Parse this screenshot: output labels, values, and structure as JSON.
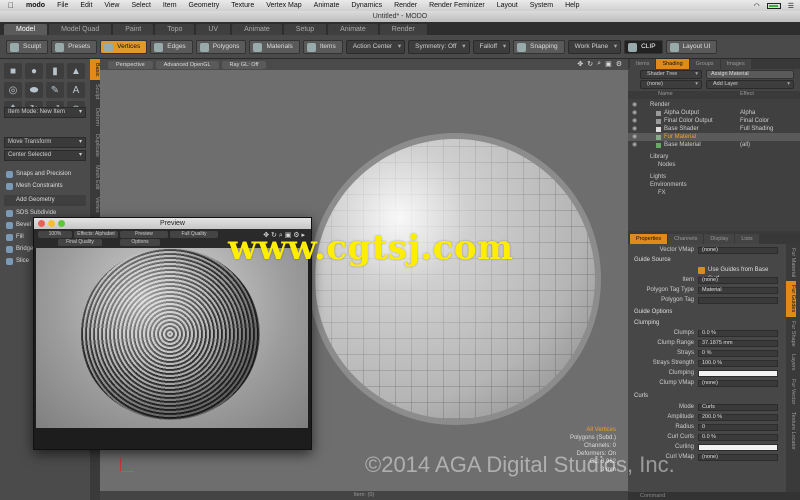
{
  "menubar": {
    "app": "modo",
    "items": [
      "File",
      "Edit",
      "View",
      "Select",
      "Item",
      "Geometry",
      "Texture",
      "Vertex Map",
      "Animate",
      "Dynamics",
      "Render",
      "Render Feminizer",
      "Layout",
      "System",
      "Help"
    ]
  },
  "window": {
    "title": "Untitled* - MODO"
  },
  "layout_tabs": [
    "Model",
    "Model Quad",
    "Paint",
    "Topo",
    "UV",
    "Animate",
    "Setup",
    "Animate",
    "Render"
  ],
  "toolbar": {
    "buttons": [
      "Sculpt",
      "Presets",
      "Vertices",
      "Edges",
      "Polygons",
      "Materials",
      "Items"
    ],
    "dropdowns": [
      "Action Center",
      "Symmetry: Off",
      "Falloff"
    ],
    "snapping": "Snapping",
    "work_plane": "Work Plane",
    "clip": "CLIP",
    "layout_label": "Layout UI"
  },
  "left_panel": {
    "vtabs": [
      "Basic",
      "Sculpt",
      "Deform",
      "Duplicate",
      "Mesh Edit",
      "Vertex"
    ],
    "dropdown1": "Item Mode: New Item",
    "transform": "Move Transform",
    "center": "Center Selected",
    "btn_snaps": "Snaps and Precision",
    "btn_mesh": "Mesh Constraints",
    "btn_add": "Add Geometry",
    "list_items": [
      "SDS Subdivide",
      "Bevel",
      "Fill",
      "Bridge",
      "Slice"
    ]
  },
  "viewport": {
    "tabs": [
      "Perspective",
      "Advanced OpenGL",
      "Ray GL: Off"
    ],
    "stats": [
      "All Vertices",
      "Polygons (Subd.)",
      "Channels: 0",
      "Deformers: On",
      "GL: 8,962",
      "3 mm"
    ],
    "footer": "Item: (0)"
  },
  "preview": {
    "title": "Preview",
    "buttons": [
      "100%",
      "Effects: Alphabet",
      "Preview",
      "Full Quality",
      "Final Quality",
      "Options"
    ]
  },
  "shading": {
    "tabs": [
      "Items",
      "Shading",
      "Groups",
      "Images"
    ],
    "view": "Shader Tree",
    "assign": "Assign Material",
    "filter": "(none)",
    "add_layer": "Add Layer",
    "col_name": "Name",
    "col_effect": "Effect",
    "rows": [
      {
        "name": "Render",
        "effect": "",
        "indent": 0
      },
      {
        "name": "Alpha Output",
        "effect": "Alpha",
        "indent": 1
      },
      {
        "name": "Final Color Output",
        "effect": "Final Color",
        "indent": 1
      },
      {
        "name": "Base Shader",
        "effect": "Full Shading",
        "indent": 1
      },
      {
        "name": "Fur Material",
        "effect": "",
        "indent": 1
      },
      {
        "name": "Base Material",
        "effect": "(all)",
        "indent": 1
      },
      {
        "name": "Library",
        "effect": "",
        "indent": 0
      },
      {
        "name": "Nodes",
        "effect": "",
        "indent": 1
      },
      {
        "name": "Lights",
        "effect": "",
        "indent": 0
      },
      {
        "name": "Environments",
        "effect": "",
        "indent": 0
      },
      {
        "name": "FX",
        "effect": "",
        "indent": 1
      }
    ]
  },
  "properties": {
    "tabs": [
      "Properties",
      "Channels",
      "Display",
      "Lists"
    ],
    "side_tabs": [
      "Fur Material",
      "Fur Guides",
      "Fur Shape",
      "Layers",
      "Fur Vector",
      "Texture Locator"
    ],
    "rows": [
      {
        "kind": "field",
        "label": "Vector VMap",
        "value": "(none)"
      },
      {
        "kind": "section",
        "label": "Guide Source"
      },
      {
        "kind": "check",
        "label": "",
        "value": "Use Guides from Base Surf..."
      },
      {
        "kind": "field",
        "label": "Item",
        "value": "(none)"
      },
      {
        "kind": "field",
        "label": "Polygon Tag Type",
        "value": "Material"
      },
      {
        "kind": "field",
        "label": "Polygon Tag",
        "value": ""
      },
      {
        "kind": "section",
        "label": "Guide Options"
      },
      {
        "kind": "section",
        "label": "Clumping"
      },
      {
        "kind": "field",
        "label": "Clumps",
        "value": "0.0 %"
      },
      {
        "kind": "field",
        "label": "Clump Range",
        "value": "37.1875 mm"
      },
      {
        "kind": "field",
        "label": "Strays",
        "value": "0 %"
      },
      {
        "kind": "field",
        "label": "Strays Strength",
        "value": "100.0 %"
      },
      {
        "kind": "white",
        "label": "Clumping",
        "value": ""
      },
      {
        "kind": "field",
        "label": "Clump VMap",
        "value": "(none)"
      },
      {
        "kind": "section",
        "label": "Curls"
      },
      {
        "kind": "field",
        "label": "Mode",
        "value": "Curls"
      },
      {
        "kind": "field",
        "label": "Amplitude",
        "value": "200.0 %"
      },
      {
        "kind": "field",
        "label": "Radius",
        "value": "0"
      },
      {
        "kind": "field",
        "label": "Curl Curls",
        "value": "0.0 %"
      },
      {
        "kind": "white",
        "label": "Curling",
        "value": ""
      },
      {
        "kind": "field",
        "label": "Curl VMap",
        "value": "(none)"
      }
    ]
  },
  "command_bar": "Command",
  "watermarks": {
    "site": "www.cgtsj.com",
    "copyright": "©2014 AGA Digital Studios, Inc."
  }
}
